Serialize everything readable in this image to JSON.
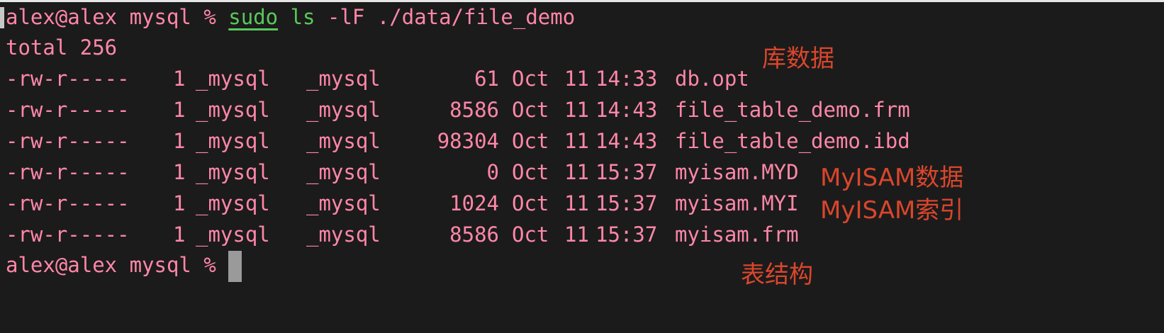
{
  "terminal": {
    "prompt": "alex@alex mysql %",
    "command": {
      "sudo": "sudo",
      "ls": "ls",
      "args": "-lF ./data/file_demo"
    },
    "total": "total 256",
    "files": [
      {
        "perm": "-rw-r-----",
        "links": "1",
        "owner": "_mysql",
        "group": "_mysql",
        "size": "61",
        "month": "Oct",
        "day": "11",
        "time": "14:33",
        "name": "db.opt"
      },
      {
        "perm": "-rw-r-----",
        "links": "1",
        "owner": "_mysql",
        "group": "_mysql",
        "size": "8586",
        "month": "Oct",
        "day": "11",
        "time": "14:43",
        "name": "file_table_demo.frm"
      },
      {
        "perm": "-rw-r-----",
        "links": "1",
        "owner": "_mysql",
        "group": "_mysql",
        "size": "98304",
        "month": "Oct",
        "day": "11",
        "time": "14:43",
        "name": "file_table_demo.ibd"
      },
      {
        "perm": "-rw-r-----",
        "links": "1",
        "owner": "_mysql",
        "group": "_mysql",
        "size": "0",
        "month": "Oct",
        "day": "11",
        "time": "15:37",
        "name": "myisam.MYD"
      },
      {
        "perm": "-rw-r-----",
        "links": "1",
        "owner": "_mysql",
        "group": "_mysql",
        "size": "1024",
        "month": "Oct",
        "day": "11",
        "time": "15:37",
        "name": "myisam.MYI"
      },
      {
        "perm": "-rw-r-----",
        "links": "1",
        "owner": "_mysql",
        "group": "_mysql",
        "size": "8586",
        "month": "Oct",
        "day": "11",
        "time": "15:37",
        "name": "myisam.frm"
      }
    ],
    "final_prompt": "alex@alex mysql %"
  },
  "annotations": {
    "db_data": "库数据",
    "myisam_data": "MyISAM数据",
    "myisam_index": "MyISAM索引",
    "table_structure": "表结构"
  },
  "colors": {
    "background": "#1b1b1b",
    "output_text": "#ff87a8",
    "command_green": "#59c95a",
    "annotation_red": "#d9462c",
    "cursor": "#9a9a9a"
  }
}
